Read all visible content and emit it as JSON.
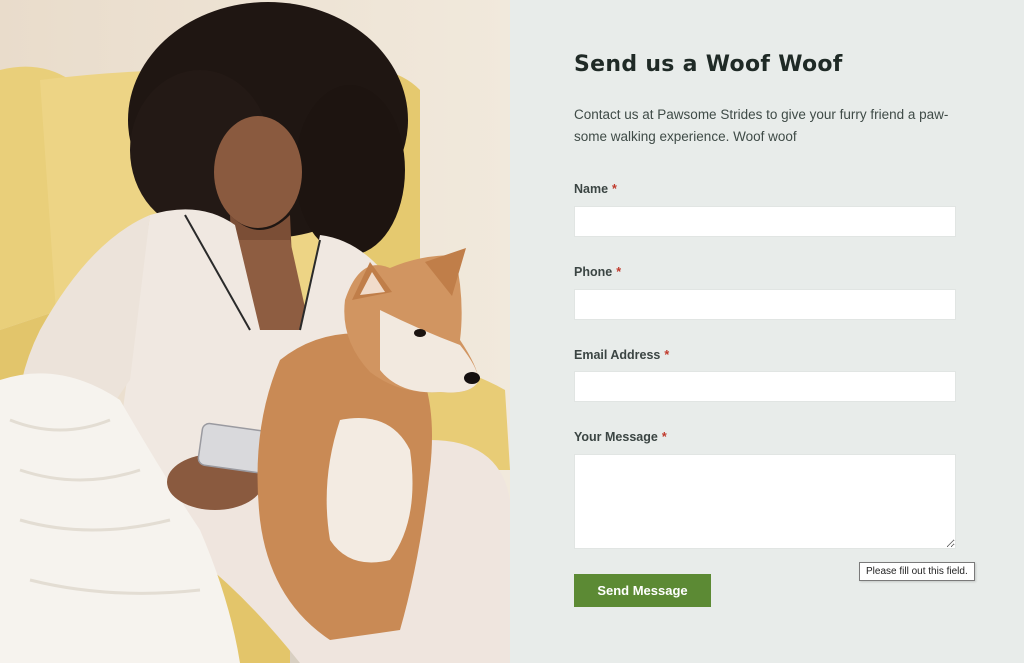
{
  "photo": {
    "subject": "woman-with-dog-photo"
  },
  "form": {
    "title": "Send us a Woof Woof",
    "intro": "Contact us at Pawsome Strides to give your furry friend a paw-some walking experience. Woof woof",
    "required_marker": "*",
    "fields": [
      {
        "label": "Name",
        "value": ""
      },
      {
        "label": "Phone",
        "value": ""
      },
      {
        "label": "Email Address",
        "value": ""
      },
      {
        "label": "Your Message",
        "value": ""
      }
    ],
    "submit_label": "Send Message",
    "validation_tooltip": "Please fill out this field."
  },
  "colors": {
    "panel_bg": "#e8ecea",
    "button_bg": "#5c8a34",
    "required": "#c0392b",
    "title": "#1f2a26"
  }
}
